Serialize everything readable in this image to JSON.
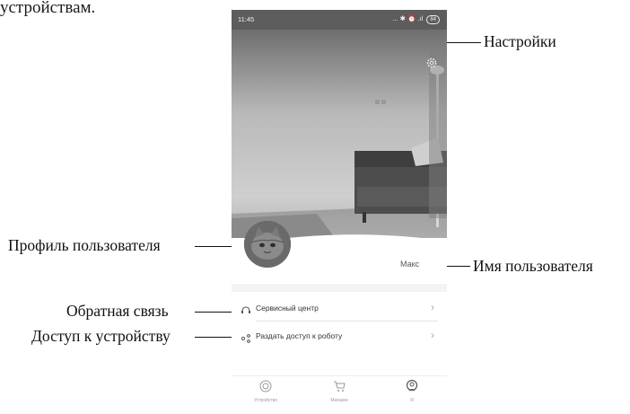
{
  "document": {
    "top_fragment": "устройствам."
  },
  "callouts": {
    "settings": "Настройки",
    "profile": "Профиль пользователя",
    "username": "Имя пользователя",
    "feedback": "Обратная связь",
    "device_access": "Доступ к устройству"
  },
  "phone": {
    "status_bar": {
      "time": "11:45",
      "icons": "... ✱ ⏰ .ıl",
      "battery": "84"
    },
    "profile": {
      "username": "Макс"
    },
    "menu": [
      {
        "label": "Сервисный центр",
        "icon": "support-icon"
      },
      {
        "label": "Раздать доступ к роботу",
        "icon": "share-icon"
      }
    ],
    "tabs": [
      {
        "label": "Устройство",
        "icon": "device-icon"
      },
      {
        "label": "Магазин",
        "icon": "cart-icon"
      },
      {
        "label": "Я",
        "icon": "profile-icon"
      }
    ]
  }
}
